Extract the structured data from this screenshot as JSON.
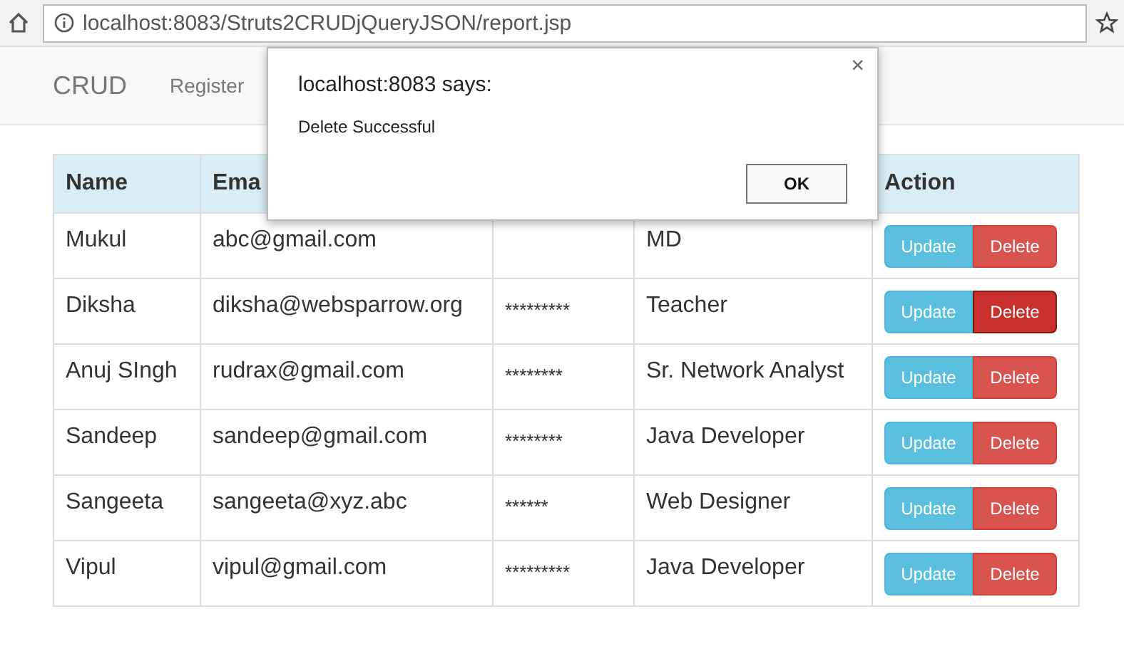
{
  "browser": {
    "url": "localhost:8083/Struts2CRUDjQueryJSON/report.jsp"
  },
  "navbar": {
    "brand": "CRUD",
    "links": [
      "Register"
    ]
  },
  "table": {
    "columns": [
      "Name",
      "Ema",
      null,
      null,
      "Action"
    ],
    "rows": [
      {
        "name": "Mukul",
        "email": "abc@gmail.com",
        "job": "MD",
        "update": "Update",
        "delete": "Delete",
        "pressed": false
      },
      {
        "name": "Diksha",
        "email": "diksha@websparrow.org",
        "password": "*********",
        "job": "Teacher",
        "update": "Update",
        "delete": "Delete",
        "pressed": true
      },
      {
        "name": "Anuj SIngh",
        "email": "rudrax@gmail.com",
        "password": "********",
        "job": "Sr. Network Analyst",
        "update": "Update",
        "delete": "Delete",
        "pressed": false
      },
      {
        "name": "Sandeep",
        "email": "sandeep@gmail.com",
        "password": "********",
        "job": "Java Developer",
        "update": "Update",
        "delete": "Delete",
        "pressed": false
      },
      {
        "name": "Sangeeta",
        "email": "sangeeta@xyz.abc",
        "password": "******",
        "job": "Web Designer",
        "update": "Update",
        "delete": "Delete",
        "pressed": false
      },
      {
        "name": "Vipul",
        "email": "vipul@gmail.com",
        "password": "*********",
        "job": "Java Developer",
        "update": "Update",
        "delete": "Delete",
        "pressed": false
      }
    ]
  },
  "dialog": {
    "title": "localhost:8083 says:",
    "message": "Delete Successful",
    "close": "×",
    "button": "OK"
  }
}
